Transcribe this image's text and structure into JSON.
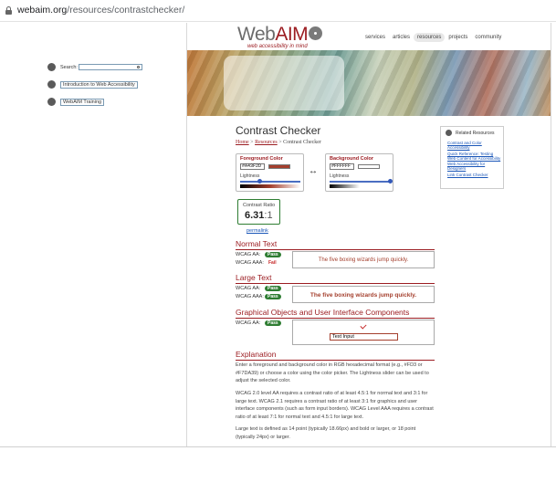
{
  "browser": {
    "url_host": "webaim.org",
    "url_path": "/resources/contrastchecker/"
  },
  "logo": {
    "text_part1": "Web",
    "text_part2": "AIM",
    "tagline": "web accessibility in mind"
  },
  "nav": [
    "services",
    "articles",
    "resources",
    "projects",
    "community"
  ],
  "hero": {
    "search_label": "Search:",
    "search_value": "",
    "link1": "Introduction to Web Accessibility",
    "link2": "WebAIM Training"
  },
  "page": {
    "title": "Contrast Checker",
    "breadcrumb": {
      "home": "Home",
      "sep": ">",
      "resources": "Resources",
      "current": "Contrast Checker"
    }
  },
  "foreground": {
    "heading": "Foreground Color",
    "hex": "#A43F2D",
    "color": "#A43F2D",
    "lightness_label": "Lightness",
    "lightness": 0.33
  },
  "background": {
    "heading": "Background Color",
    "hex": "#FFFFFF",
    "color": "#FFFFFF",
    "lightness_label": "Lightness",
    "lightness": 1.0
  },
  "swap_glyph": "↔",
  "ratio": {
    "label": "Contrast Ratio",
    "value": "6.31",
    "suffix": ":1"
  },
  "permalink": "permalink",
  "normal_text": {
    "heading": "Normal Text",
    "aa_label": "WCAG AA:",
    "aa_result": "Pass",
    "aaa_label": "WCAG AAA:",
    "aaa_result": "Fail",
    "sample": "The five boxing wizards jump quickly."
  },
  "large_text": {
    "heading": "Large Text",
    "aa_label": "WCAG AA:",
    "aa_result": "Pass",
    "aaa_label": "WCAG AAA:",
    "aaa_result": "Pass",
    "sample": "The five boxing wizards jump quickly."
  },
  "graphical": {
    "heading": "Graphical Objects and User Interface Components",
    "aa_label": "WCAG AA:",
    "aa_result": "Pass",
    "input_value": "Text Input"
  },
  "explanation": {
    "heading": "Explanation",
    "p1": "Enter a foreground and background color in RGB hexadecimal format (e.g., #FD3 or #F7DA39) or choose a color using the color picker. The Lightness slider can be used to adjust the selected color.",
    "p2": "WCAG 2.0 level AA requires a contrast ratio of at least 4.5:1 for normal text and 3:1 for large text. WCAG 2.1 requires a contrast ratio of at least 3:1 for graphics and user interface components (such as form input borders). WCAG Level AAA requires a contrast ratio of at least 7:1 for normal text and 4.5:1 for large text.",
    "p3": "Large text is defined as 14 point (typically 18.66px) and bold or larger, or 18 point (typically 24px) or larger."
  },
  "related": {
    "heading": "Related Resources",
    "links": [
      "Contrast and Color Accessibility",
      "Quick Reference: Testing Web Content for Accessibility",
      "Web Accessibility for Designers",
      "Link Contrast Checker"
    ]
  },
  "colors": {
    "accent": "#9c1d22",
    "pass": "#2e7d32",
    "fail": "#c62828",
    "link": "#1a56b8"
  }
}
